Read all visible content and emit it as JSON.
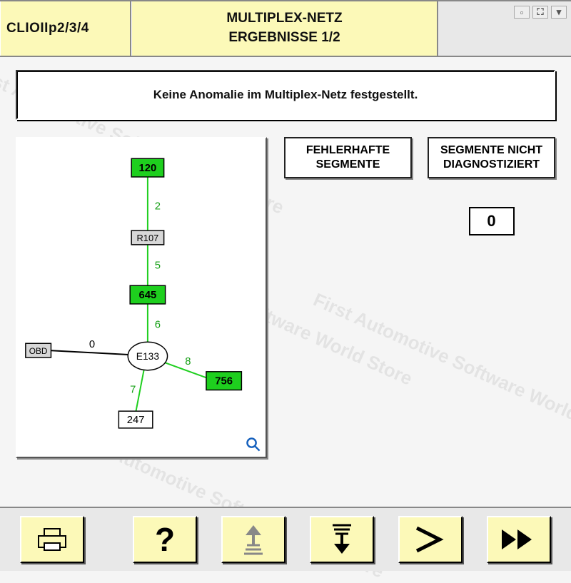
{
  "header": {
    "vehicle": "CLIOIIp2/3/4",
    "title_line1": "MULTIPLEX-NETZ",
    "title_line2": "ERGEBNISSE 1/2"
  },
  "message": "Keine Anomalie im Multiplex-Netz festgestellt.",
  "panels": {
    "faulty_segments_label": "FEHLERHAFTE SEGMENTE",
    "not_diagnosed_label": "SEGMENTE NICHT DIAGNOSTIZIERT",
    "not_diagnosed_count": "0"
  },
  "diagram": {
    "nodes": {
      "top_green": "120",
      "r107": "R107",
      "mid_green": "645",
      "obd": "OBD",
      "e133": "E133",
      "right_green": "756",
      "bottom_white": "247"
    },
    "edges": {
      "e_2": "2",
      "e_5": "5",
      "e_6": "6",
      "e_0": "0",
      "e_8": "8",
      "e_7": "7"
    }
  },
  "colors": {
    "panel_yellow": "#fcf9b8",
    "node_green": "#1ecf1e"
  },
  "watermark": "First Automotive Software World Store"
}
